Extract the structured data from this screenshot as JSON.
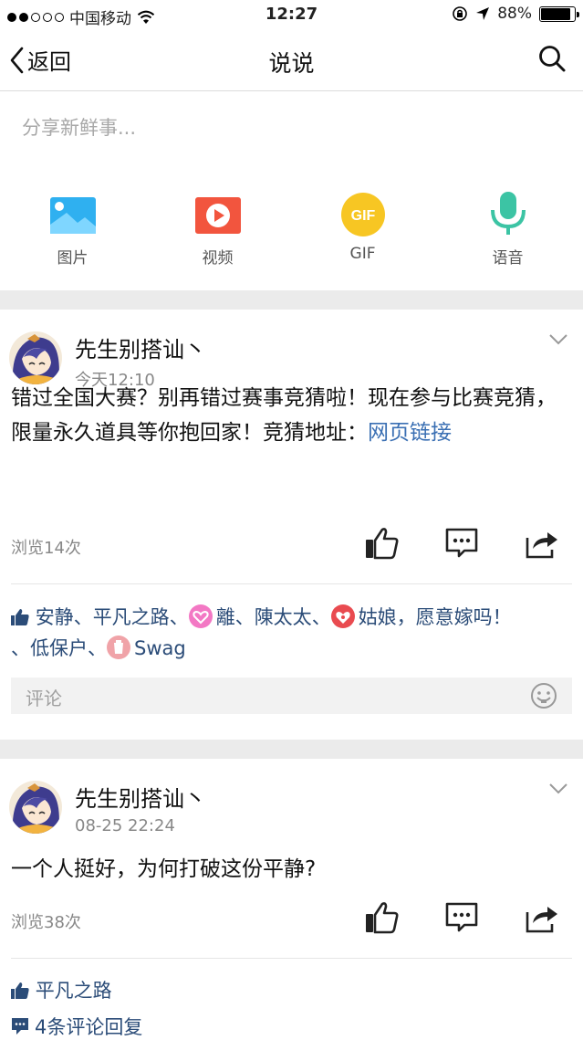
{
  "status_bar": {
    "carrier": "中国移动",
    "time": "12:27",
    "battery": "88%",
    "battery_level": 0.88
  },
  "nav": {
    "back_label": "返回",
    "title": "说说"
  },
  "composer": {
    "placeholder": "分享新鲜事...",
    "media": [
      {
        "label": "图片",
        "icon": "image-icon"
      },
      {
        "label": "视频",
        "icon": "video-icon"
      },
      {
        "label": "GIF",
        "icon": "gif-icon",
        "badge_text": "GIF"
      },
      {
        "label": "语音",
        "icon": "microphone-icon"
      }
    ]
  },
  "posts": [
    {
      "author": "先生别搭讪丶",
      "time": "今天12:10",
      "text": "错过全国大赛？别再错过赛事竞猜啦！现在参与比赛竞猜，限量永久道具等你抱回家！竞猜地址：",
      "link": "网页链接",
      "views": "浏览14次",
      "likes": {
        "a": "安静",
        "b": "平凡之路",
        "c": "離",
        "d": "陳太太",
        "e": "姑娘，愿意嫁吗！",
        "f": "低保户",
        "g": "Swag"
      },
      "comment_placeholder": "评论"
    },
    {
      "author": "先生别搭讪丶",
      "time": "08-25 22:24",
      "text": "一个人挺好，为何打破这份平静?",
      "views": "浏览38次",
      "likes": {
        "a": "平凡之路"
      },
      "replies": "4条评论回复"
    }
  ],
  "colors": {
    "link": "#3a6fb3",
    "names": "#2b4c78",
    "separator": "#ebebeb"
  }
}
